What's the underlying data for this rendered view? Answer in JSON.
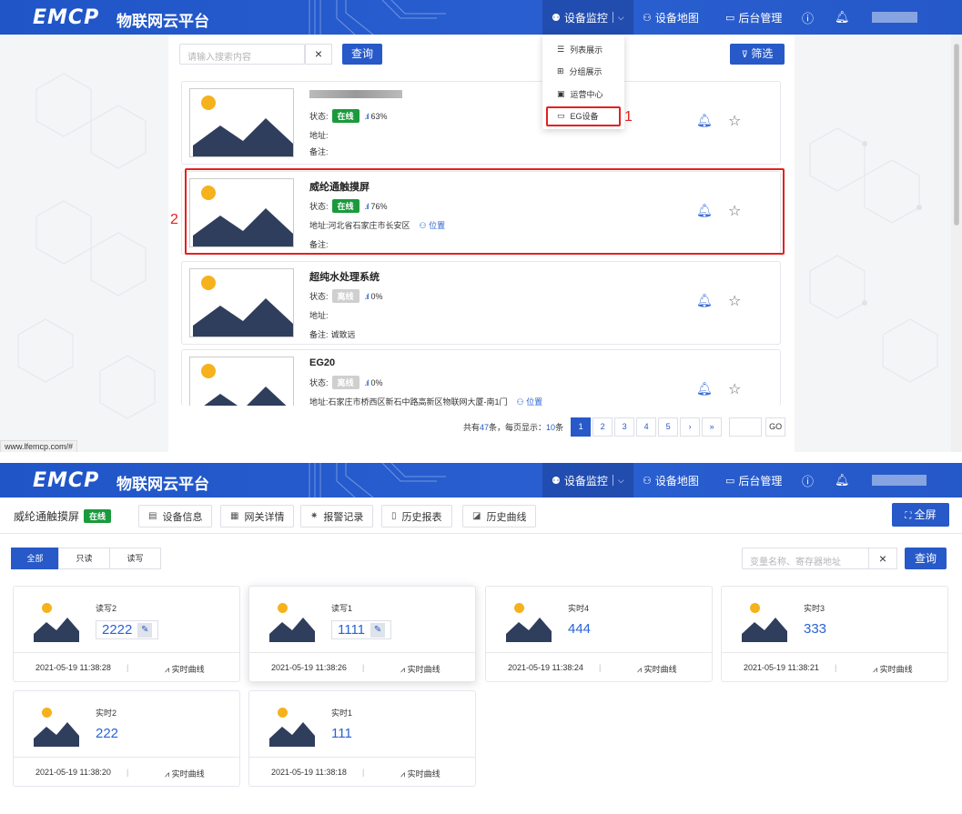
{
  "app": {
    "logo": "EMCP",
    "title": "物联网云平台"
  },
  "nav": {
    "monitor": "设备监控",
    "map": "设备地图",
    "admin": "后台管理"
  },
  "dropdown": {
    "items": [
      "列表展示",
      "分组展示",
      "运营中心",
      "EG设备"
    ]
  },
  "annotations": {
    "label1": "1",
    "label2": "2"
  },
  "list": {
    "search_placeholder": "请输入搜索内容",
    "clear_icon": "×",
    "query_label": "查询",
    "filter_label": "筛选",
    "devices": [
      {
        "name": "",
        "status_label": "状态:",
        "status": "在线",
        "signal": "63%",
        "addr_label": "地址:",
        "addr": "",
        "note_label": "备注:",
        "note": "",
        "location": ""
      },
      {
        "name": "威纶通触摸屏",
        "status_label": "状态:",
        "status": "在线",
        "signal": "76%",
        "addr_label": "地址:",
        "addr": "河北省石家庄市长安区",
        "note_label": "备注:",
        "note": "",
        "location": "位置"
      },
      {
        "name": "超纯水处理系统",
        "status_label": "状态:",
        "status": "离线",
        "signal": "0%",
        "addr_label": "地址:",
        "addr": "",
        "note_label": "备注:",
        "note": "诚致远",
        "location": ""
      },
      {
        "name": "EG20",
        "status_label": "状态:",
        "status": "离线",
        "signal": "0%",
        "addr_label": "地址:",
        "addr": "石家庄市桥西区新石中路高新区物联网大厦-南1门",
        "note_label": "",
        "note": "",
        "location": "位置"
      }
    ],
    "pager": {
      "total_prefix": "共有",
      "total": "47",
      "total_suffix": "条，每页显示：",
      "per_page": "10",
      "per_page_suffix": "条",
      "pages": [
        "1",
        "2",
        "3",
        "4",
        "5"
      ],
      "next": "›",
      "last": "»",
      "go": "GO",
      "current": 1
    },
    "status_url": "www.lfemcp.com/#"
  },
  "detail": {
    "device_name": "威纶通触摸屏",
    "status": "在线",
    "tabs": [
      "设备信息",
      "网关详情",
      "报警记录",
      "历史报表",
      "历史曲线"
    ],
    "fullscreen": "全屏",
    "filters": [
      "全部",
      "只读",
      "读写"
    ],
    "search_placeholder": "变量名称、寄存器地址",
    "clear_icon": "×",
    "query_label": "查询",
    "curve_label": "实时曲线",
    "variables": [
      {
        "name": "读写2",
        "value": "2222",
        "editable": true,
        "time": "2021-05-19 11:38:28"
      },
      {
        "name": "读写1",
        "value": "1111",
        "editable": true,
        "time": "2021-05-19 11:38:26"
      },
      {
        "name": "实时4",
        "value": "444",
        "editable": false,
        "time": "2021-05-19 11:38:24"
      },
      {
        "name": "实时3",
        "value": "333",
        "editable": false,
        "time": "2021-05-19 11:38:21"
      },
      {
        "name": "实时2",
        "value": "222",
        "editable": false,
        "time": "2021-05-19 11:38:20"
      },
      {
        "name": "实时1",
        "value": "111",
        "editable": false,
        "time": "2021-05-19 11:38:18"
      }
    ]
  },
  "colors": {
    "primary": "#2759c8",
    "online": "#1a9a3c",
    "offline": "#cfcfcf",
    "annotation": "#e52020"
  }
}
